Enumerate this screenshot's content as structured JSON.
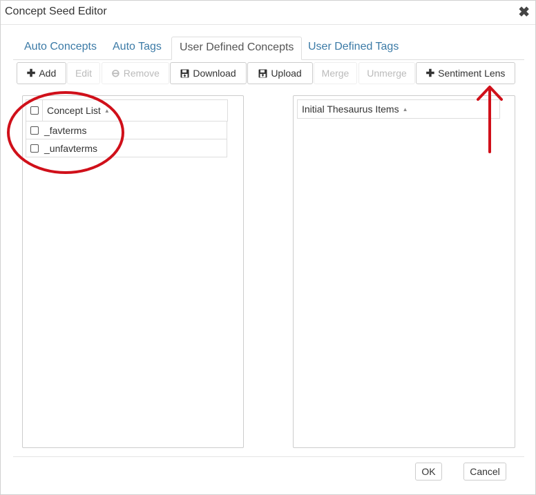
{
  "window": {
    "title": "Concept Seed Editor"
  },
  "tabs": [
    {
      "label": "Auto Concepts"
    },
    {
      "label": "Auto Tags"
    },
    {
      "label": "User Defined Concepts"
    },
    {
      "label": "User Defined Tags"
    }
  ],
  "toolbar": {
    "add": "Add",
    "edit": "Edit",
    "remove": "Remove",
    "download": "Download",
    "upload": "Upload",
    "merge": "Merge",
    "unmerge": "Unmerge",
    "sentiment_lens": "Sentiment Lens"
  },
  "concept_list": {
    "header": "Concept List",
    "rows": [
      {
        "label": "_favterms"
      },
      {
        "label": "_unfavterms"
      }
    ]
  },
  "thesaurus": {
    "header": "Initial Thesaurus Items"
  },
  "footer": {
    "ok": "OK",
    "cancel": "Cancel"
  },
  "annotation_color": "#d0101a"
}
